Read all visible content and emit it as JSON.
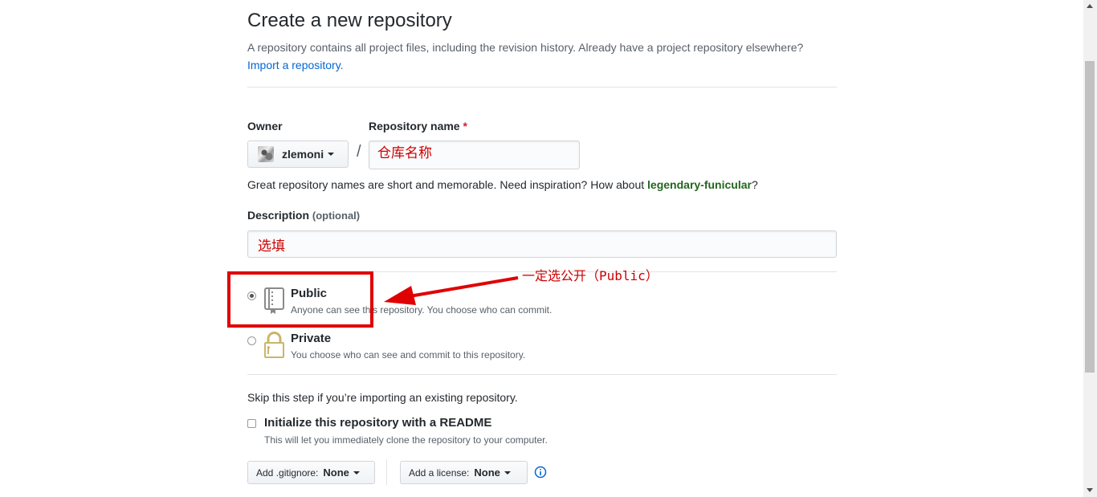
{
  "header": {
    "title": "Create a new repository",
    "description": "A repository contains all project files, including the revision history. Already have a project repository elsewhere?",
    "import_link": "Import a repository."
  },
  "owner": {
    "label": "Owner",
    "name": "zlemoni"
  },
  "repo_name": {
    "label": "Repository name",
    "required_mark": "*",
    "value": "仓库名称"
  },
  "hint": {
    "prefix": "Great repository names are short and memorable. Need inspiration? How about ",
    "suggestion": "legendary-funicular",
    "suffix": "?"
  },
  "description_field": {
    "label": "Description",
    "optional": "(optional)",
    "value": "选填"
  },
  "visibility": {
    "public_title": "Public",
    "public_desc": "Anyone can see this repository. You choose who can commit.",
    "private_title": "Private",
    "private_desc": "You choose who can see and commit to this repository.",
    "selected": "public"
  },
  "init": {
    "skip_text": "Skip this step if you’re importing an existing repository.",
    "readme_label": "Initialize this repository with a README",
    "readme_desc": "This will let you immediately clone the repository to your computer."
  },
  "gitignore": {
    "label": "Add .gitignore:",
    "value": "None"
  },
  "license": {
    "label": "Add a license:",
    "value": "None"
  },
  "annotation": {
    "text": "一定选公开（Public）"
  },
  "colors": {
    "annotation": "#cc0000",
    "link": "#0366d6",
    "suggestion": "#22661f"
  },
  "icons": [
    "repo-icon",
    "lock-icon",
    "info-icon",
    "avatar"
  ]
}
